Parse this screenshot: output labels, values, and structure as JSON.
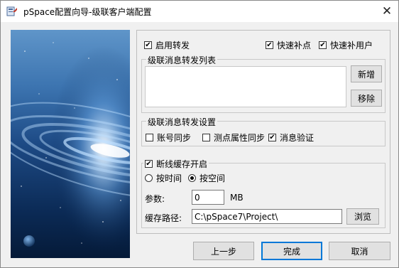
{
  "window": {
    "title": "pSpace配置向导-级联客户端配置",
    "app_icon": "wizard-app-icon",
    "close_symbol": "✕"
  },
  "options": {
    "enable_forward": {
      "label": "启用转发",
      "checked": true
    },
    "fast_fill": {
      "label": "快速补点",
      "checked": true
    },
    "fast_fill_user": {
      "label": "快速补用户",
      "checked": true
    }
  },
  "forward_list": {
    "label": "级联消息转发列表",
    "items": [],
    "add_label": "新增",
    "remove_label": "移除"
  },
  "forward_settings": {
    "label": "级联消息转发设置",
    "account_sync": {
      "label": "账号同步",
      "checked": false
    },
    "point_attr_sync": {
      "label": "测点属性同步",
      "checked": false
    },
    "message_verify": {
      "label": "消息验证",
      "checked": true
    }
  },
  "cache": {
    "enable": {
      "label": "断线缓存开启",
      "checked": true
    },
    "by_time": {
      "label": "按时间",
      "selected": false
    },
    "by_space": {
      "label": "按空间",
      "selected": true
    },
    "param_label": "参数:",
    "param_value": "0",
    "param_unit": "MB",
    "path_label": "缓存路径:",
    "path_value": "C:\\pSpace7\\Project\\",
    "browse_label": "浏览"
  },
  "footer": {
    "prev_label": "上一步",
    "finish_label": "完成",
    "cancel_label": "取消"
  },
  "colors": {
    "accent": "#0078d7",
    "banner_dark": "#08203f",
    "banner_light": "#9fd0ff"
  }
}
